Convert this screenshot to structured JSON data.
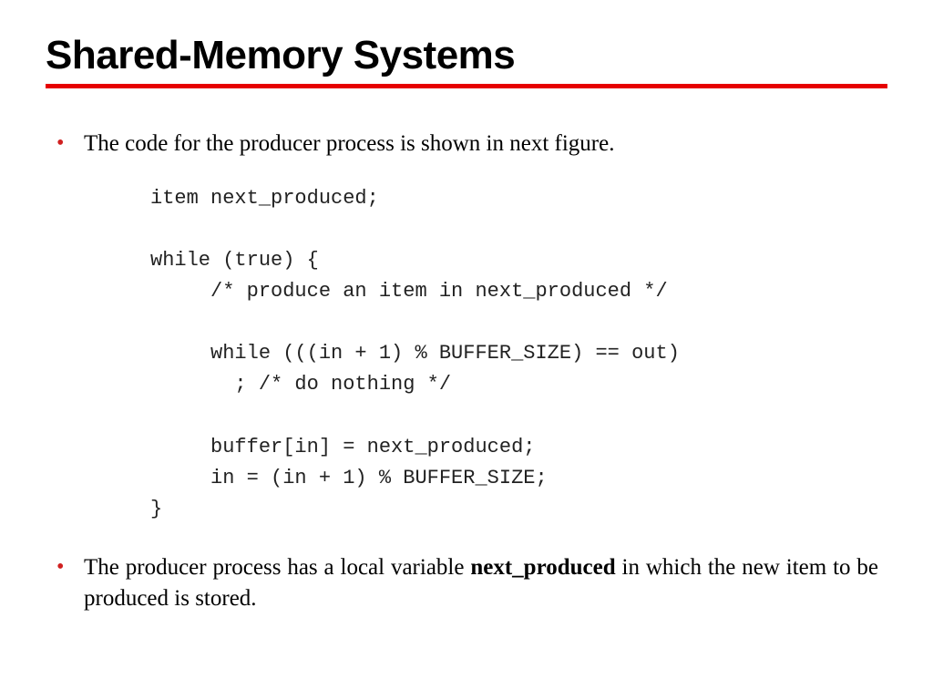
{
  "title": "Shared-Memory Systems",
  "bullets": {
    "first": "The code for the producer process is shown in next figure.",
    "second_pre": " The producer process has a local variable ",
    "second_bold": "next_produced",
    "second_post": " in which the new item to be produced is stored."
  },
  "code": "item next_produced;\n\nwhile (true) {\n     /* produce an item in next_produced */\n\n     while (((in + 1) % BUFFER_SIZE) == out)\n       ; /* do nothing */\n\n     buffer[in] = next_produced;\n     in = (in + 1) % BUFFER_SIZE;\n}"
}
